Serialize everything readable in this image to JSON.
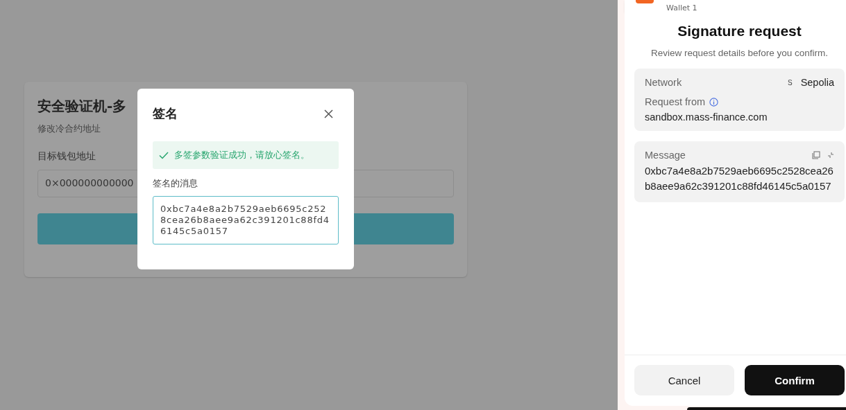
{
  "page": {
    "card": {
      "title": "安全验证机-多",
      "subtitle": "修改冷合约地址",
      "field_label": "目标钱包地址",
      "field_value": "0×000000000000"
    }
  },
  "dialog": {
    "title": "签名",
    "alert": {
      "kind": "success",
      "text": "多签参数验证成功，请放心签名。"
    },
    "message_label": "签名的消息",
    "message": "0xbc7a4e8a2b7529aeb6695c2528cea26b8aee9a62c391201c88fd46145c5a0157"
  },
  "wallet": {
    "account": "Wallet 1",
    "title": "Signature request",
    "subtitle": "Review request details before you confirm.",
    "network_label": "Network",
    "network_badge": "S",
    "network": "Sepolia",
    "request_from_label": "Request from",
    "origin": "sandbox.mass-finance.com",
    "message_label": "Message",
    "message": "0xbc7a4e8a2b7529aeb6695c2528cea26b8aee9a62c391201c88fd46145c5a0157",
    "buttons": [
      {
        "label": "Cancel",
        "kind": "secondary"
      },
      {
        "label": "Confirm",
        "kind": "primary"
      }
    ]
  }
}
